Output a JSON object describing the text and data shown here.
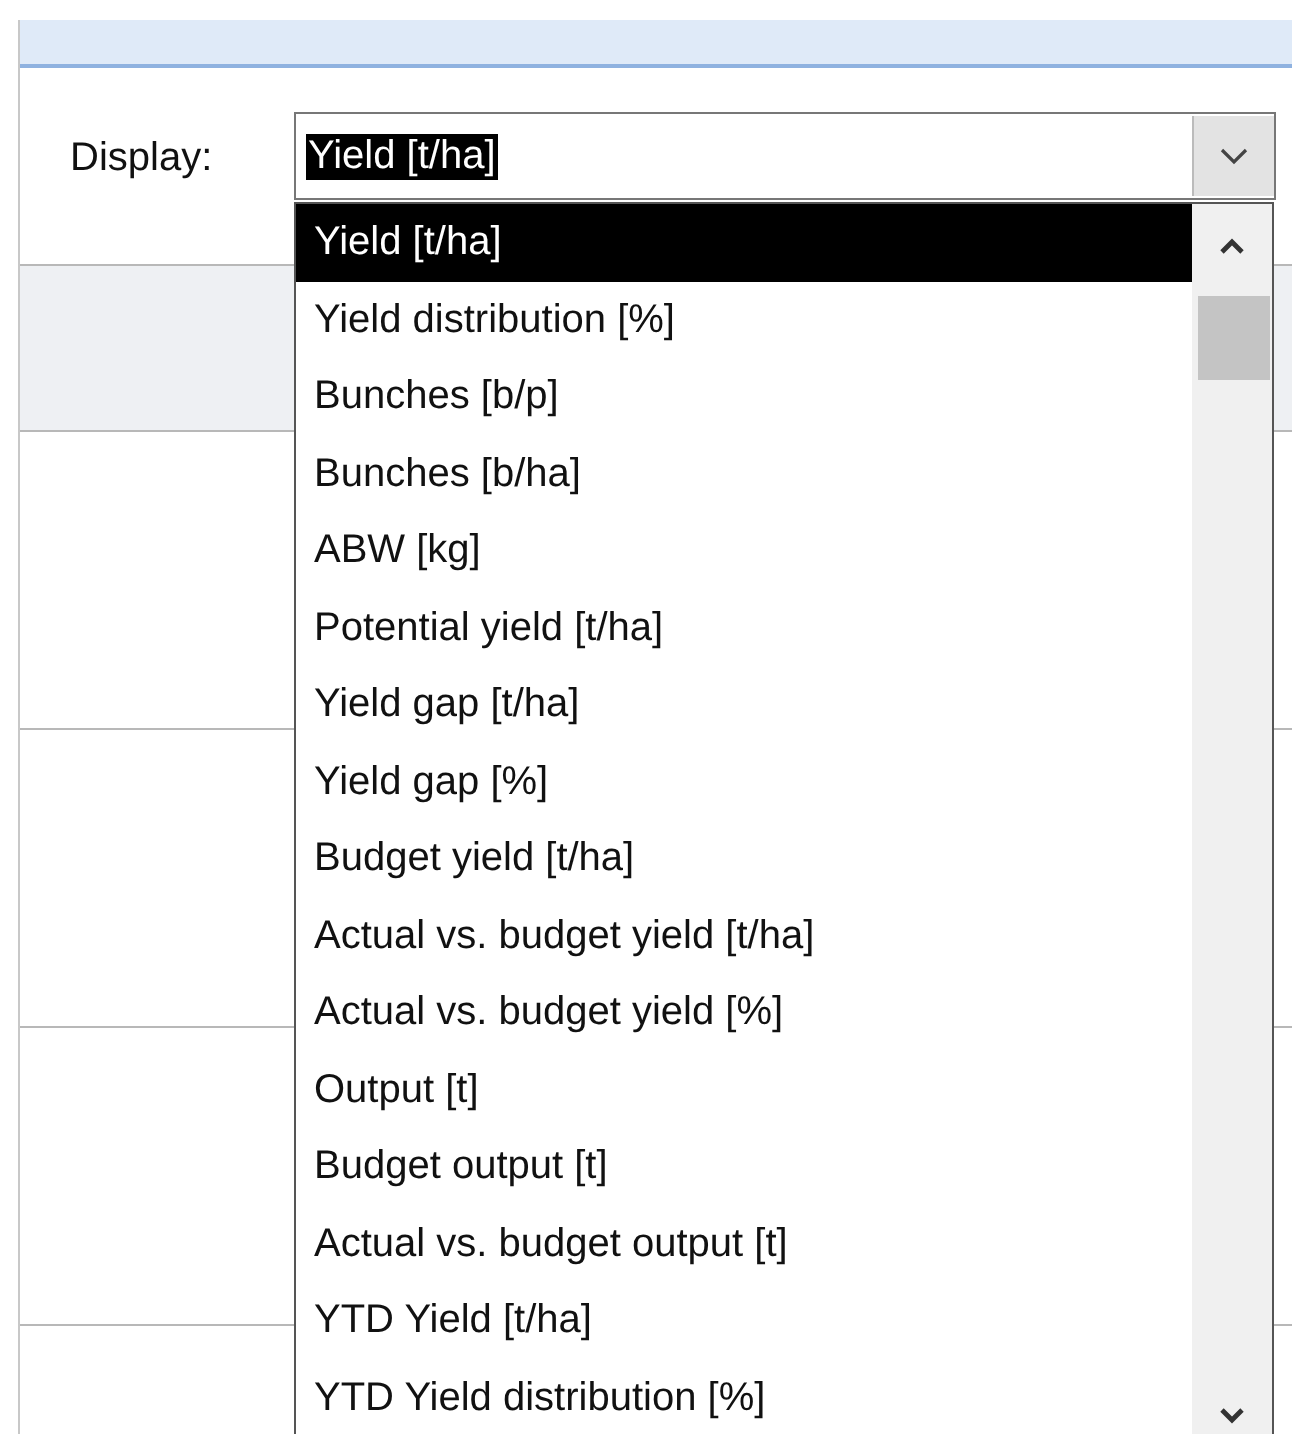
{
  "filter": {
    "label": "Display:",
    "value": "Yield [t/ha]"
  },
  "options": [
    {
      "label": "Yield [t/ha]",
      "selected": true
    },
    {
      "label": "Yield distribution [%]",
      "selected": false
    },
    {
      "label": "Bunches [b/p]",
      "selected": false
    },
    {
      "label": "Bunches [b/ha]",
      "selected": false
    },
    {
      "label": "ABW [kg]",
      "selected": false
    },
    {
      "label": "Potential yield [t/ha]",
      "selected": false
    },
    {
      "label": "Yield gap [t/ha]",
      "selected": false
    },
    {
      "label": "Yield gap [%]",
      "selected": false
    },
    {
      "label": "Budget yield [t/ha]",
      "selected": false
    },
    {
      "label": "Actual vs. budget yield [t/ha]",
      "selected": false
    },
    {
      "label": "Actual vs. budget yield [%]",
      "selected": false
    },
    {
      "label": "Output [t]",
      "selected": false
    },
    {
      "label": "Budget output [t]",
      "selected": false
    },
    {
      "label": "Actual vs. budget output [t]",
      "selected": false
    },
    {
      "label": "YTD Yield [t/ha]",
      "selected": false
    },
    {
      "label": "YTD Yield distribution [%]",
      "selected": false
    }
  ]
}
